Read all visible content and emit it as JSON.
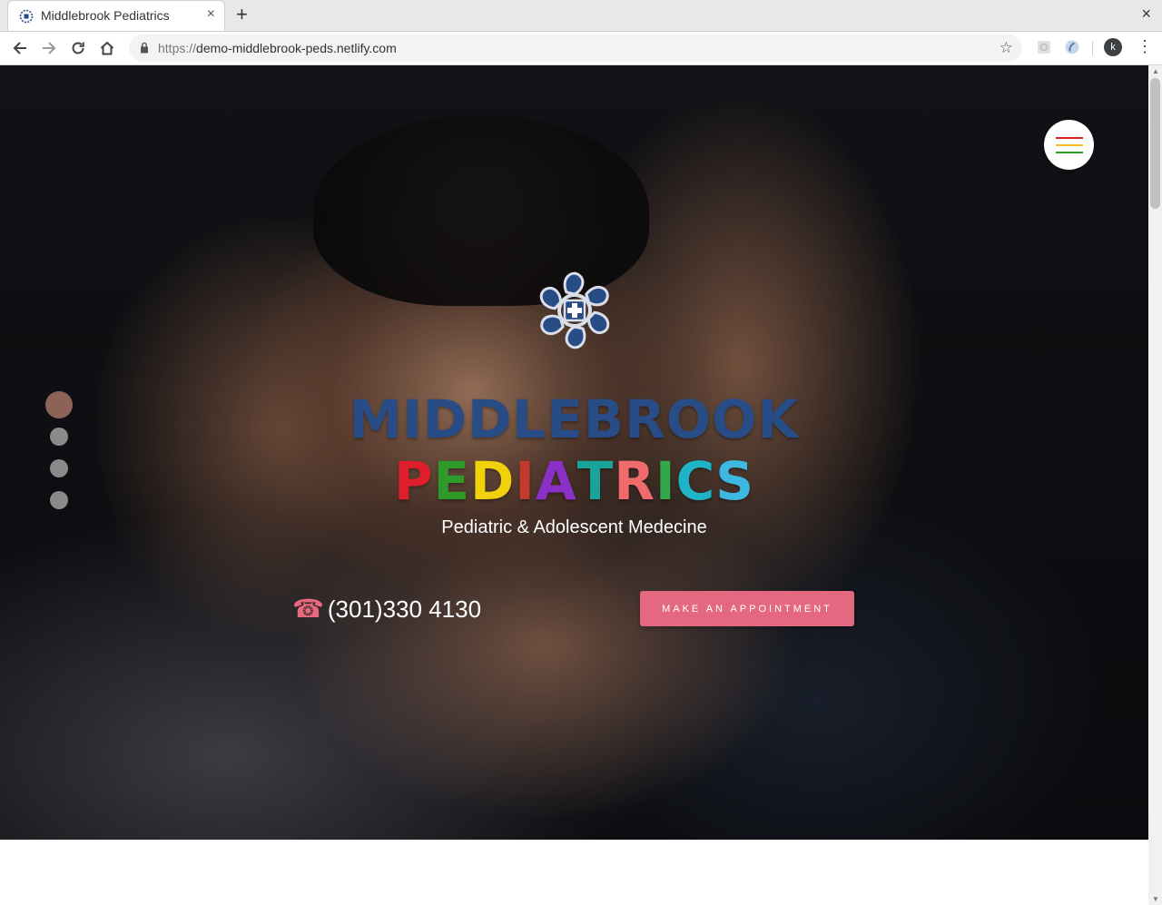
{
  "browser": {
    "tab_title": "Middlebrook Pediatrics",
    "tab_close": "×",
    "new_tab": "+",
    "window_close": "×",
    "url_protocol": "https://",
    "url_host": "demo-middlebrook-peds.netlify.com",
    "avatar_letter": "k"
  },
  "hero": {
    "brand_line1": "MIDDLEBROOK",
    "brand_line2_letters": [
      {
        "ch": "P",
        "color": "#e01e2b"
      },
      {
        "ch": "E",
        "color": "#2e9a2a"
      },
      {
        "ch": "D",
        "color": "#f0d20a"
      },
      {
        "ch": "I",
        "color": "#c23a2b"
      },
      {
        "ch": "A",
        "color": "#8b2fc9"
      },
      {
        "ch": "T",
        "color": "#1aa39a"
      },
      {
        "ch": "R",
        "color": "#f06c6c"
      },
      {
        "ch": "I",
        "color": "#32a84a"
      },
      {
        "ch": "C",
        "color": "#1fb3c7"
      },
      {
        "ch": "S",
        "color": "#3db8e0"
      }
    ],
    "tagline": "Pediatric & Adolescent Medecine",
    "phone_icon": "☎",
    "phone": "(301)330 4130",
    "cta_label": "MAKE AN APPOINTMENT"
  },
  "slider": {
    "active_index": 0,
    "count": 4
  },
  "colors": {
    "brand_blue": "#274c86",
    "accent_pink": "#e4687f",
    "menu_lines": [
      "#e01e2b",
      "#f0c419",
      "#2e9a2a"
    ]
  }
}
